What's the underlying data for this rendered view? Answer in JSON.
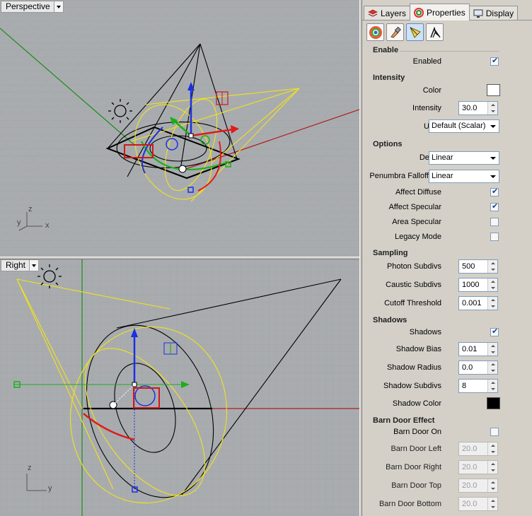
{
  "viewports": {
    "perspective": {
      "title": "Perspective",
      "axes": {
        "x": "x",
        "y": "y",
        "z": "z"
      }
    },
    "right": {
      "title": "Right",
      "axes": {
        "y": "y",
        "z": "z"
      }
    }
  },
  "panel": {
    "tabs": [
      {
        "label": "Layers",
        "icon": "layers-icon"
      },
      {
        "label": "Properties",
        "icon": "properties-icon",
        "active": true
      },
      {
        "label": "Display",
        "icon": "display-icon"
      }
    ],
    "toolbar": [
      {
        "icon": "color-wheel-icon"
      },
      {
        "icon": "material-brush-icon"
      },
      {
        "icon": "spotlight-icon",
        "selected": true
      },
      {
        "icon": "render-plugin-icon"
      }
    ],
    "enable": {
      "title": "Enable",
      "enabled_label": "Enabled",
      "enabled": true
    },
    "intensity": {
      "title": "Intensity",
      "color_label": "Color",
      "color": "#ffffff",
      "intensity_label": "Intensity",
      "intensity_value": "30.0",
      "units_label": "Units",
      "units_value": "Default (Scalar)"
    },
    "options": {
      "title": "Options",
      "decay_label": "Decay",
      "decay_value": "Linear",
      "penumbra_label": "Penumbra Falloff",
      "penumbra_value": "Linear",
      "affect_diffuse_label": "Affect Diffuse",
      "affect_diffuse": true,
      "affect_specular_label": "Affect Specular",
      "affect_specular": true,
      "area_specular_label": "Area Specular",
      "area_specular": false,
      "legacy_mode_label": "Legacy Mode",
      "legacy_mode": false
    },
    "sampling": {
      "title": "Sampling",
      "photon_subdivs_label": "Photon Subdivs",
      "photon_subdivs": "500",
      "caustic_subdivs_label": "Caustic Subdivs",
      "caustic_subdivs": "1000",
      "cutoff_label": "Cutoff Threshold",
      "cutoff": "0.001"
    },
    "shadows": {
      "title": "Shadows",
      "shadows_label": "Shadows",
      "shadows": true,
      "bias_label": "Shadow Bias",
      "bias": "0.01",
      "radius_label": "Shadow Radius",
      "radius": "0.0",
      "subdivs_label": "Shadow Subdivs",
      "subdivs": "8",
      "color_label": "Shadow Color",
      "color": "#000000"
    },
    "barn_door": {
      "title": "Barn Door Effect",
      "on_label": "Barn Door On",
      "on": false,
      "left_label": "Barn Door Left",
      "left": "20.0",
      "right_label": "Barn Door Right",
      "right": "20.0",
      "top_label": "Barn Door Top",
      "top": "20.0",
      "bottom_label": "Barn Door Bottom",
      "bottom": "20.0"
    }
  }
}
